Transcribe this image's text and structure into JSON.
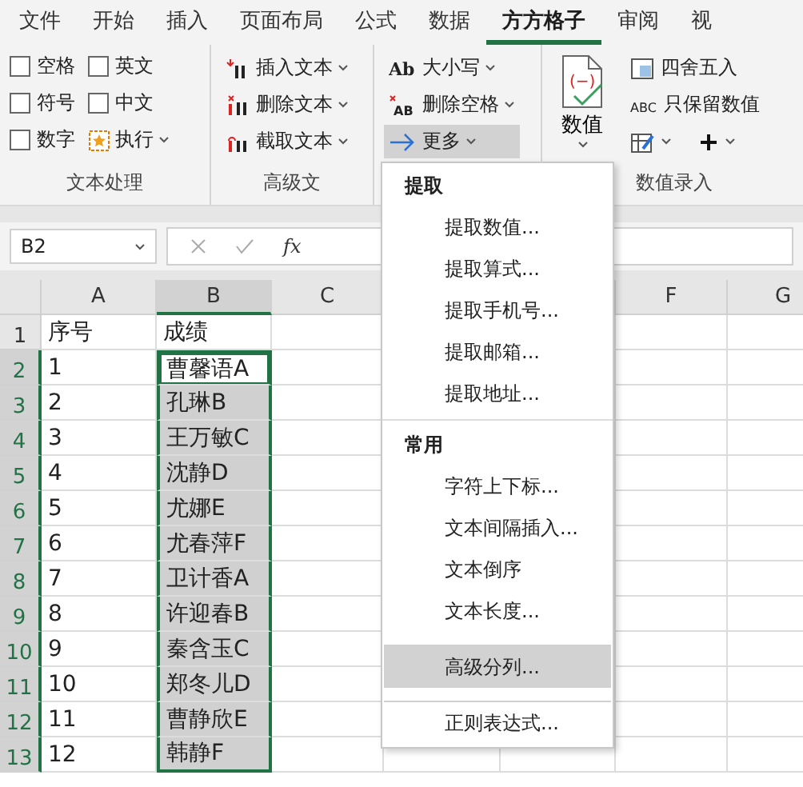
{
  "tabs": [
    {
      "label": "文件",
      "selected": false
    },
    {
      "label": "开始",
      "selected": false
    },
    {
      "label": "插入",
      "selected": false
    },
    {
      "label": "页面布局",
      "selected": false
    },
    {
      "label": "公式",
      "selected": false
    },
    {
      "label": "数据",
      "selected": false
    },
    {
      "label": "方方格子",
      "selected": true
    },
    {
      "label": "审阅",
      "selected": false
    },
    {
      "label": "视",
      "selected": false
    }
  ],
  "ribbon": {
    "groups": [
      {
        "kind": "checks",
        "label": "文本处理",
        "options": [
          {
            "label": "空格",
            "checked": false
          },
          {
            "label": "英文",
            "checked": false
          },
          {
            "label": "符号",
            "checked": false
          },
          {
            "label": "中文",
            "checked": false
          },
          {
            "label": "数字",
            "checked": false
          }
        ],
        "action": "执行"
      },
      {
        "kind": "commands",
        "label": "高级文",
        "commands": [
          {
            "label": "插入文本",
            "pressed": false
          },
          {
            "label": "删除文本",
            "pressed": false
          },
          {
            "label": "截取文本",
            "pressed": false
          }
        ]
      },
      {
        "kind": "commands",
        "commands": [
          {
            "label": "大小写",
            "pressed": false,
            "icon_text": "Ab"
          },
          {
            "label": "删除空格",
            "pressed": false,
            "icon_text": "AB"
          },
          {
            "label": "更多",
            "pressed": true
          }
        ]
      },
      {
        "kind": "number",
        "label": "数值录入",
        "big": "数值",
        "big_icon_text": "(−)",
        "commands": [
          {
            "label": "四舍五入",
            "pressed": false
          },
          {
            "label": "只保留数值",
            "pressed": false,
            "icon_text": "ABC"
          }
        ]
      }
    ]
  },
  "formula_bar": {
    "name_box": "B2",
    "fx": "fx"
  },
  "sheet": {
    "columns": [
      "A",
      "B",
      "C",
      "F",
      "G"
    ],
    "rows": [
      {
        "number": "1",
        "a": "序号",
        "b": "成绩",
        "selected": false,
        "active": false
      },
      {
        "number": "2",
        "a": "1",
        "b": "曹馨语A",
        "selected": true,
        "active": true
      },
      {
        "number": "3",
        "a": "2",
        "b": "孔琳B",
        "selected": true,
        "active": false
      },
      {
        "number": "4",
        "a": "3",
        "b": "王万敏C",
        "selected": true,
        "active": false
      },
      {
        "number": "5",
        "a": "4",
        "b": "沈静D",
        "selected": true,
        "active": false
      },
      {
        "number": "6",
        "a": "5",
        "b": "尤娜E",
        "selected": true,
        "active": false
      },
      {
        "number": "7",
        "a": "6",
        "b": "尤春萍F",
        "selected": true,
        "active": false
      },
      {
        "number": "8",
        "a": "7",
        "b": "卫计香A",
        "selected": true,
        "active": false
      },
      {
        "number": "9",
        "a": "8",
        "b": "许迎春B",
        "selected": true,
        "active": false
      },
      {
        "number": "10",
        "a": "9",
        "b": "秦含玉C",
        "selected": true,
        "active": false
      },
      {
        "number": "11",
        "a": "10",
        "b": "郑冬儿D",
        "selected": true,
        "active": false
      },
      {
        "number": "12",
        "a": "11",
        "b": "曹静欣E",
        "selected": true,
        "active": false
      },
      {
        "number": "13",
        "a": "12",
        "b": "韩静F",
        "selected": true,
        "active": false
      }
    ]
  },
  "menu": {
    "sections": [
      {
        "title": "提取",
        "items": [
          {
            "label": "提取数值...",
            "highlighted": false,
            "separated": false
          },
          {
            "label": "提取算式...",
            "highlighted": false,
            "separated": false
          },
          {
            "label": "提取手机号...",
            "highlighted": false,
            "separated": false
          },
          {
            "label": "提取邮箱...",
            "highlighted": false,
            "separated": false
          },
          {
            "label": "提取地址...",
            "highlighted": false,
            "separated": false
          }
        ]
      },
      {
        "title": "常用",
        "items": [
          {
            "label": "字符上下标...",
            "highlighted": false,
            "separated": false
          },
          {
            "label": "文本间隔插入...",
            "highlighted": false,
            "separated": false
          },
          {
            "label": "文本倒序",
            "highlighted": false,
            "separated": false
          },
          {
            "label": "文本长度...",
            "highlighted": false,
            "separated": false
          },
          {
            "label": "高级分列...",
            "highlighted": true,
            "separated": true
          },
          {
            "label": "正则表达式...",
            "highlighted": false,
            "separated": true
          }
        ]
      }
    ]
  }
}
